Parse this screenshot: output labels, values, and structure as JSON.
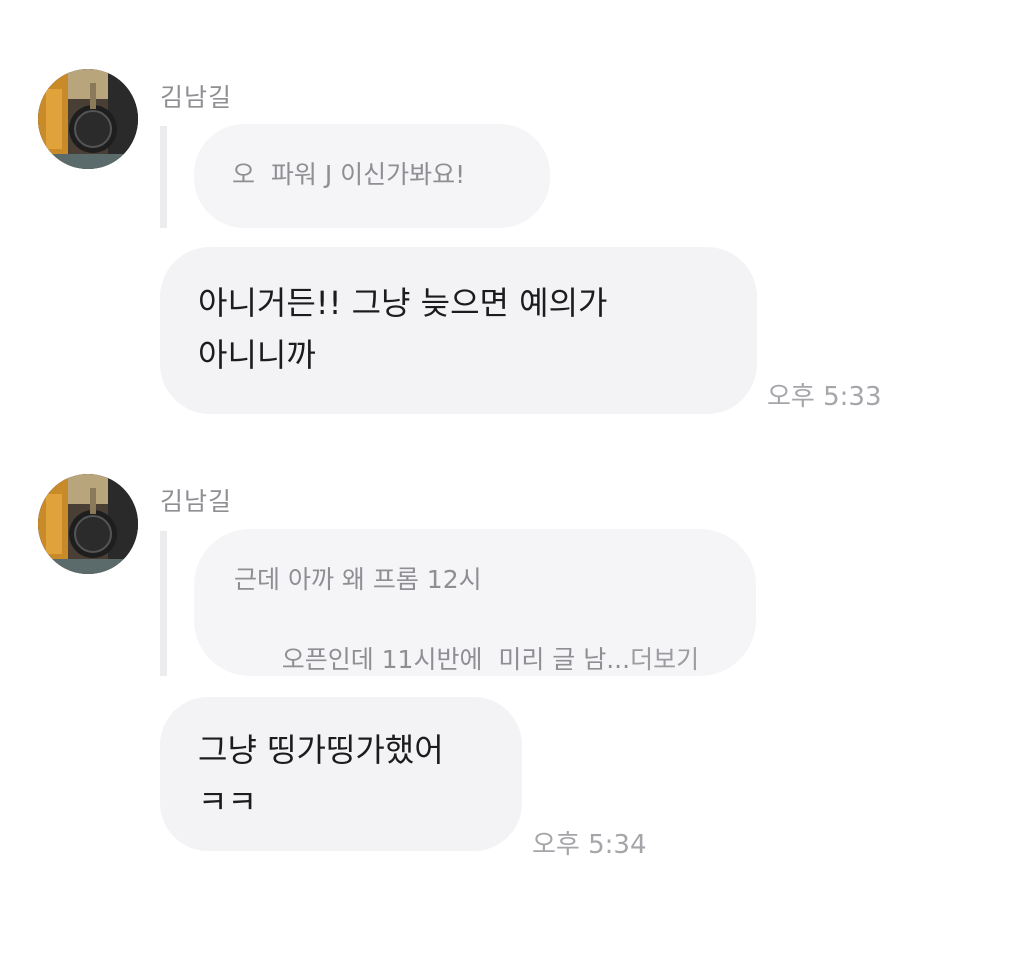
{
  "messages": [
    {
      "sender": "김남길",
      "quote": {
        "lines": [
          "오  파워 J 이신가봐요!"
        ],
        "more": ""
      },
      "text_lines": [
        "아니거든!! 그냥 늦으면 예의가",
        "아니니까"
      ],
      "time": "오후 5:33"
    },
    {
      "sender": "김남길",
      "quote": {
        "lines": [
          "근데 아까 왜 프롬 12시",
          "오픈인데 11시반에  미리 글 남..."
        ],
        "more": "더보기"
      },
      "text_lines": [
        "그냥 띵가띵가했어",
        "ㅋㅋ"
      ],
      "time": "오후 5:34"
    }
  ],
  "avatar_icon": "profile-photo-microphone",
  "colors": {
    "bubble_bg": "#f3f3f6",
    "quote_bg": "#f5f5f7",
    "text": "#1c1c1e",
    "muted": "#8e8e93"
  }
}
